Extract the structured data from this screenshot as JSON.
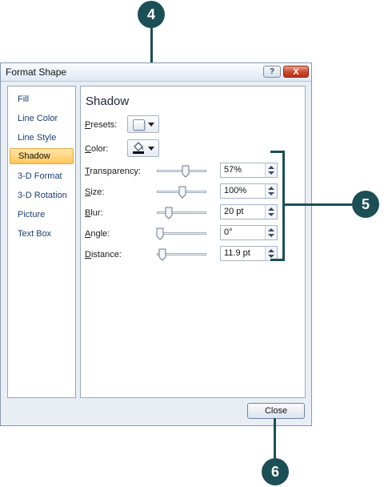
{
  "window": {
    "title": "Format Shape",
    "help_glyph": "?",
    "close_glyph": "X"
  },
  "categories": [
    {
      "label": "Fill"
    },
    {
      "label": "Line Color"
    },
    {
      "label": "Line Style"
    },
    {
      "label": "Shadow",
      "selected": true
    },
    {
      "label": "3-D Format"
    },
    {
      "label": "3-D Rotation"
    },
    {
      "label": "Picture"
    },
    {
      "label": "Text Box"
    }
  ],
  "panel": {
    "heading": "Shadow",
    "presets_label": {
      "key": "P",
      "rest": "resets:"
    },
    "color_label": {
      "key": "C",
      "rest": "olor:"
    },
    "settings": [
      {
        "key": "T",
        "rest": "ransparency:",
        "value": "57%",
        "level": 0.57
      },
      {
        "key": "S",
        "rest": "ize:",
        "value": "100%",
        "level": 0.5
      },
      {
        "key": "B",
        "rest": "lur:",
        "value": "20 pt",
        "level": 0.2
      },
      {
        "key": "A",
        "rest": "ngle:",
        "value": "0°",
        "level": 0.0
      },
      {
        "key": "D",
        "rest": "istance:",
        "value": "11.9 pt",
        "level": 0.05
      }
    ]
  },
  "buttons": {
    "close_label": "Close"
  },
  "callouts": {
    "c4": "4",
    "c5": "5",
    "c6": "6"
  },
  "colors": {
    "callout": "#1c4f55",
    "selected_bg": "#ffc75a",
    "category_text": "#1a3f72"
  }
}
